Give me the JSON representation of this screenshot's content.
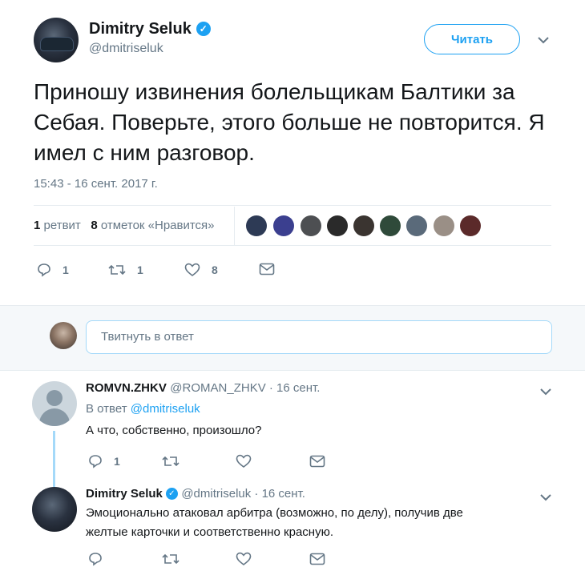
{
  "tweet": {
    "author_name": "Dimitry Seluk",
    "author_handle": "@dmitriseluk",
    "follow_label": "Читать",
    "text": "Приношу извинения болельщикам Балтики за Себая. Поверьте, этого больше не повторится. Я имел с ним разговор.",
    "timestamp": "15:43 - 16 сент. 2017 г.",
    "retweets_count": "1",
    "retweets_label": "ретвит",
    "likes_count": "8",
    "likes_label": "отметок «Нравится»",
    "actions": {
      "reply_count": "1",
      "retweet_count": "1",
      "like_count": "8"
    }
  },
  "reply_box": {
    "placeholder": "Твитнуть в ответ"
  },
  "replies": [
    {
      "name": "ROMVN.ZHKV",
      "meta": "@ROMAN_ZHKV · 16 сент.",
      "in_reply_prefix": "В ответ",
      "in_reply_handle": "@dmitriseluk",
      "text": "А что, собственно, произошло?",
      "reply_count": "1"
    },
    {
      "name": "Dimitry Seluk",
      "meta": "@dmitriseluk · 16 сент.",
      "text_line1": "Эмоционально атаковал арбитра (возможно, по делу), получив две",
      "text_line2": "желтые карточки и соответственно красную."
    }
  ],
  "colors": {
    "accent": "#1da1f2",
    "muted": "#657786",
    "border": "#e6ecf0"
  },
  "icons": [
    "verified-icon",
    "chevron-down-icon",
    "reply-icon",
    "retweet-icon",
    "like-icon",
    "message-icon"
  ]
}
